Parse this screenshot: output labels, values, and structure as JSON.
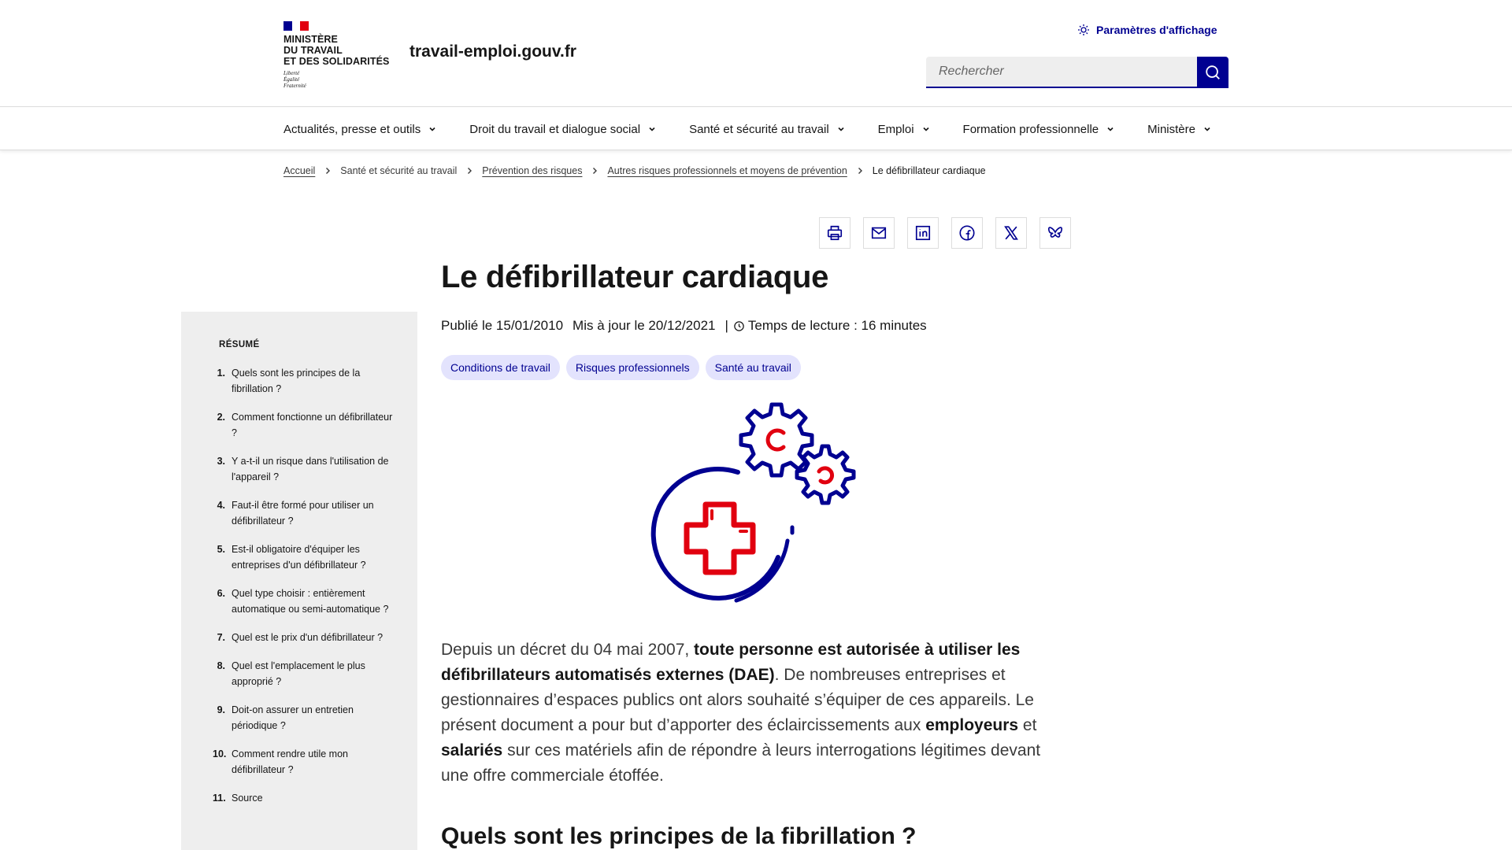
{
  "header": {
    "ministry_name": [
      "Ministère",
      "du Travail",
      "et des Solidarités"
    ],
    "motto": [
      "Liberté",
      "Égalité",
      "Fraternité"
    ],
    "site_name": "travail-emploi.gouv.fr",
    "display_settings": "Paramètres d'affichage",
    "search_placeholder": "Rechercher"
  },
  "nav": {
    "items": [
      {
        "label": "Actualités, presse et outils"
      },
      {
        "label": "Droit du travail et dialogue social"
      },
      {
        "label": "Santé et sécurité au travail"
      },
      {
        "label": "Emploi"
      },
      {
        "label": "Formation professionnelle"
      },
      {
        "label": "Ministère"
      }
    ]
  },
  "breadcrumb": [
    {
      "label": "Accueil"
    },
    {
      "label": "Santé et sécurité au travail"
    },
    {
      "label": "Prévention des risques"
    },
    {
      "label": "Autres risques professionnels et moyens de prévention"
    },
    {
      "label": "Le défibrillateur cardiaque"
    }
  ],
  "share": {
    "print": "print-icon",
    "mail": "mail-icon",
    "linkedin": "linkedin-icon",
    "facebook": "facebook-icon",
    "x": "x-icon",
    "bluesky": "bluesky-icon"
  },
  "sidebar": {
    "title": "RÉSUMÉ",
    "items": [
      {
        "num": "1.",
        "label": "Quels sont les principes de la fibrillation ?"
      },
      {
        "num": "2.",
        "label": "Comment fonctionne un défibrillateur ?"
      },
      {
        "num": "3.",
        "label": "Y a-t-il un risque dans l'utilisation de l'appareil ?"
      },
      {
        "num": "4.",
        "label": "Faut-il être formé pour utiliser un défibrillateur ?"
      },
      {
        "num": "5.",
        "label": "Est-il obligatoire d'équiper les entreprises d'un défibrillateur ?"
      },
      {
        "num": "6.",
        "label": "Quel type choisir : entièrement automatique ou semi-automatique ?"
      },
      {
        "num": "7.",
        "label": "Quel est le prix d'un défibrillateur ?"
      },
      {
        "num": "8.",
        "label": "Quel est l'emplacement le plus approprié ?"
      },
      {
        "num": "9.",
        "label": "Doit-on assurer un entretien périodique ?"
      },
      {
        "num": "10.",
        "label": "Comment rendre utile mon défibrillateur ?"
      },
      {
        "num": "11.",
        "label": "Source"
      }
    ]
  },
  "article": {
    "title": "Le défibrillateur cardiaque",
    "published": "Publié le 15/01/2010",
    "updated": "Mis à jour le 20/12/2021",
    "separator": "|",
    "reading_time": "Temps de lecture : 16 minutes",
    "tags": [
      "Conditions de travail",
      "Risques professionnels",
      "Santé au travail"
    ],
    "intro": {
      "p1": "Depuis un décret du 04 mai 2007, ",
      "b1": "toute personne est autorisée à utiliser les défibrillateurs automatisés externes (DAE)",
      "p2": ". De nombreuses entreprises et gestionnaires d’espaces publics ont alors souhaité s’équiper de ces appareils. Le présent document a pour but d’apporter des éclaircissements aux ",
      "b2": "employeurs",
      "p3": " et ",
      "b3": "salariés",
      "p4": " sur ces matériels afin de répondre à leurs interrogations légitimes devant une offre commerciale étoffée."
    },
    "section_title": "Quels sont les principes de la fibrillation ?"
  },
  "colors": {
    "primary_blue": "#000091",
    "marianne_red": "#e1000f",
    "tag_bg": "#e3e3fd",
    "sidebar_bg": "#eeeeee"
  }
}
